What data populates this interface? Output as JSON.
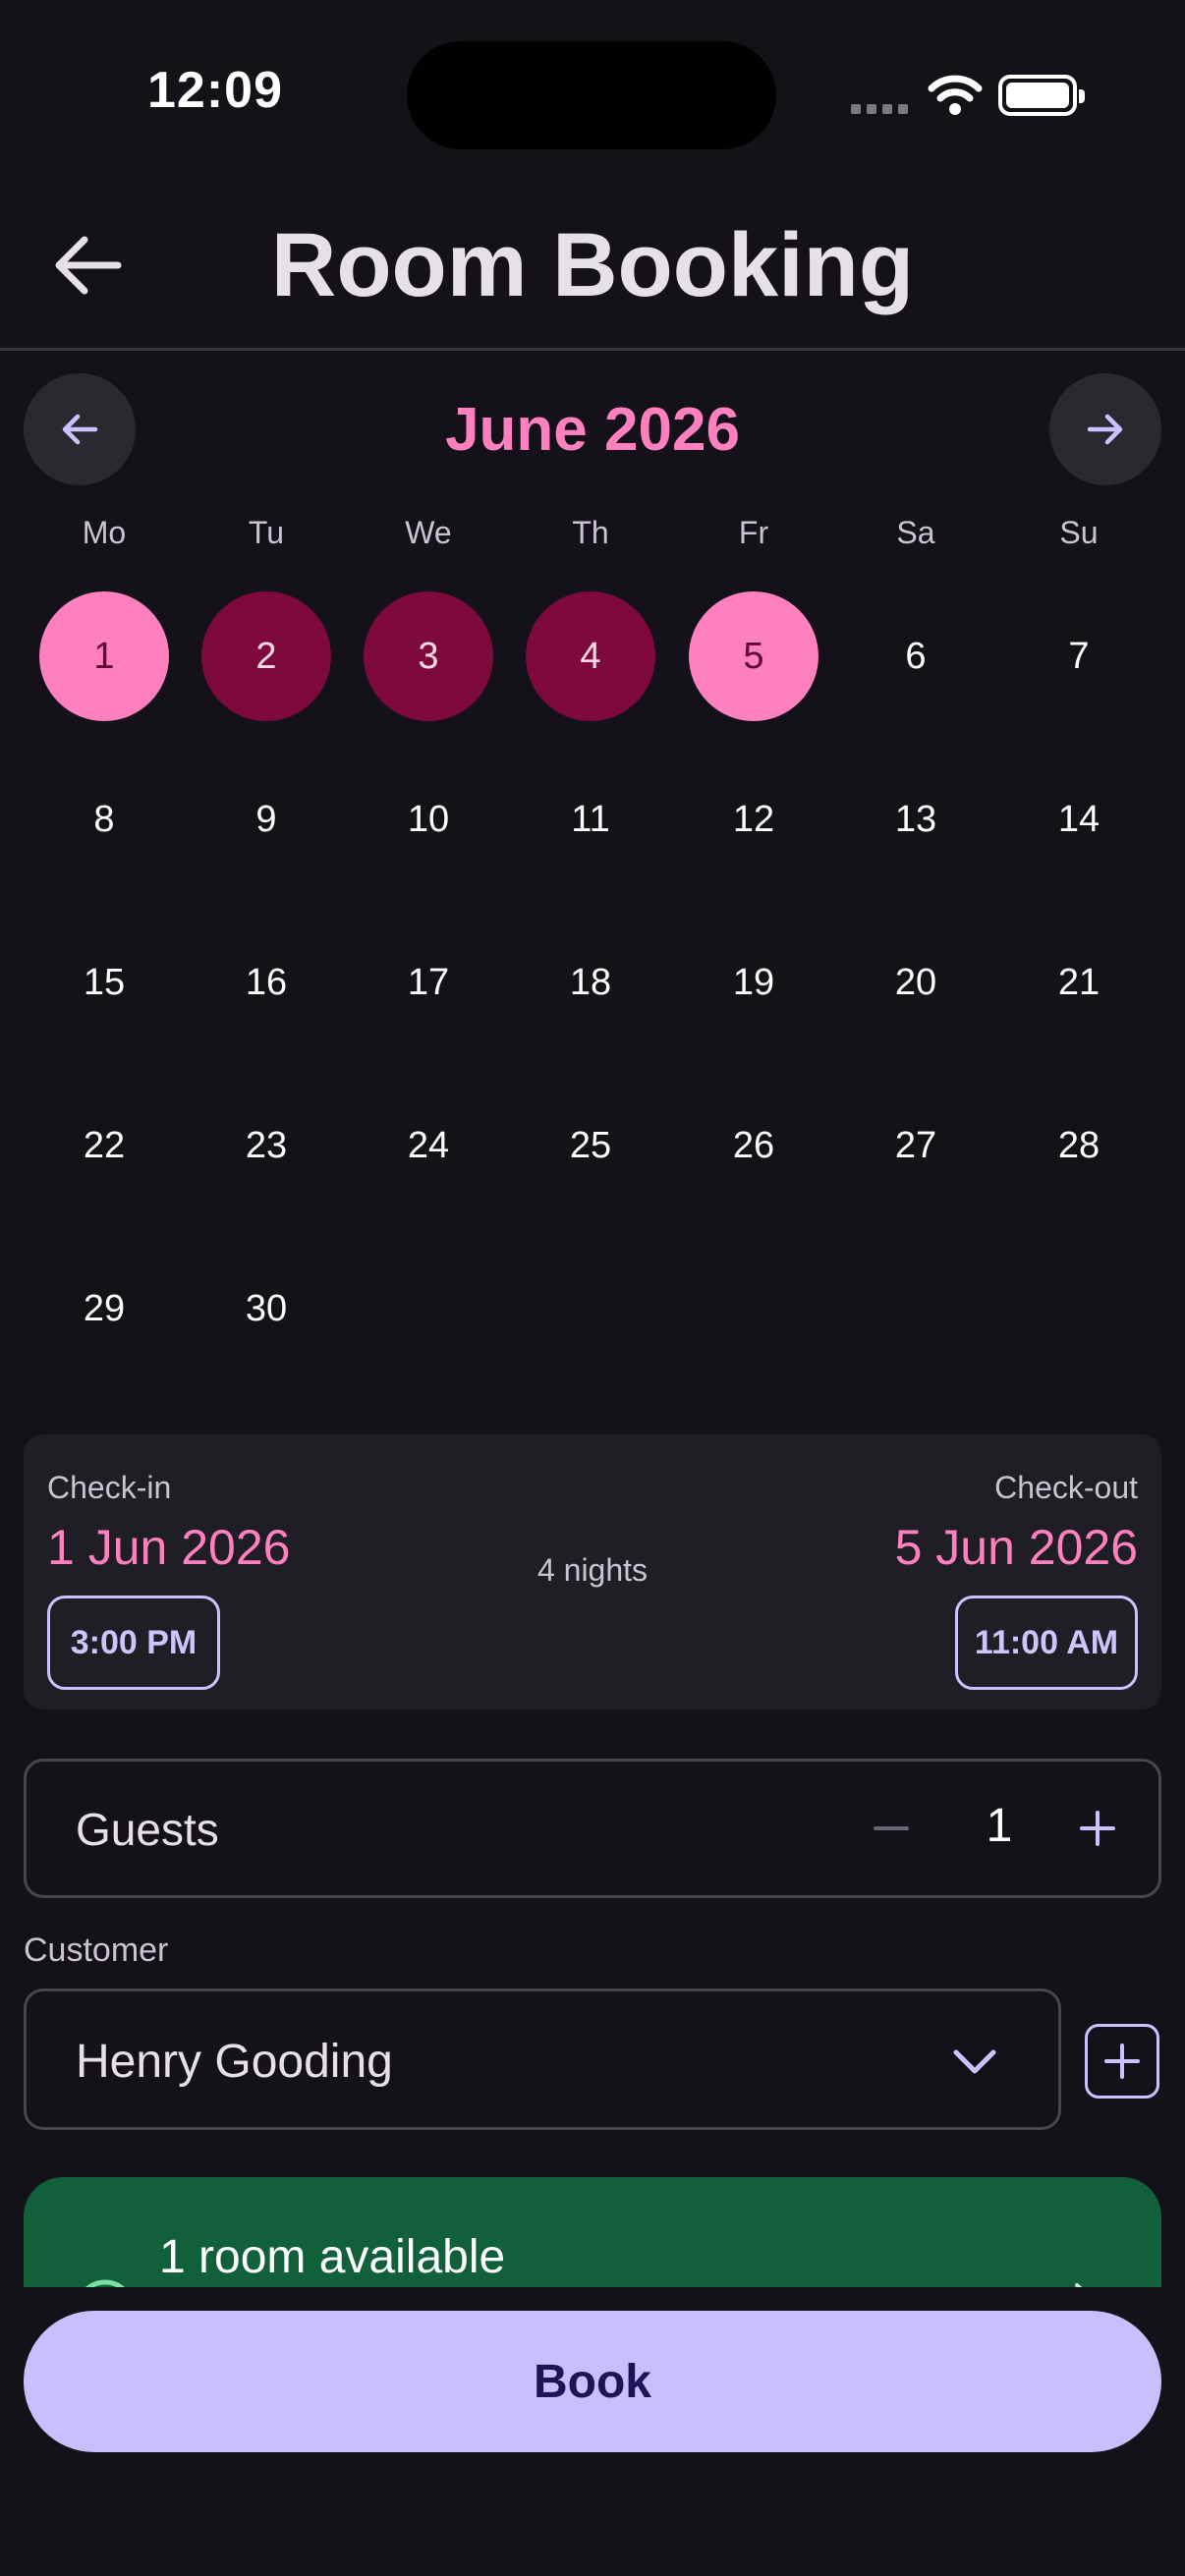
{
  "status_bar": {
    "time": "12:09"
  },
  "header": {
    "title": "Room Booking"
  },
  "calendar": {
    "month_label": "June 2026",
    "weekdays": [
      "Mo",
      "Tu",
      "We",
      "Th",
      "Fr",
      "Sa",
      "Su"
    ],
    "days": [
      "1",
      "2",
      "3",
      "4",
      "5",
      "6",
      "7",
      "8",
      "9",
      "10",
      "11",
      "12",
      "13",
      "14",
      "15",
      "16",
      "17",
      "18",
      "19",
      "20",
      "21",
      "22",
      "23",
      "24",
      "25",
      "26",
      "27",
      "28",
      "29",
      "30"
    ],
    "selected_range": {
      "start": 1,
      "end": 5
    }
  },
  "booking": {
    "checkin_label": "Check-in",
    "checkin_date": "1 Jun 2026",
    "checkin_time": "3:00 PM",
    "checkout_label": "Check-out",
    "checkout_date": "5 Jun 2026",
    "checkout_time": "11:00 AM",
    "nights": "4 nights"
  },
  "guests": {
    "label": "Guests",
    "count": "1",
    "minus": "−",
    "plus": "+"
  },
  "customer": {
    "label": "Customer",
    "selected": "Henry Gooding"
  },
  "availability": {
    "text": "1 room available"
  },
  "actions": {
    "book_label": "Book"
  },
  "colors": {
    "background": "#141218",
    "accent_pink": "#FF80BF",
    "selected_mid": "#7D0A3A",
    "accent_purple": "#C8BFFF",
    "available_green": "#11603A"
  }
}
